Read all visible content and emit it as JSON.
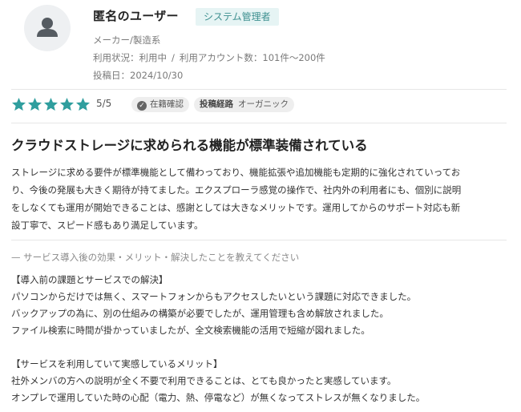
{
  "reviewer": {
    "name": "匿名のユーザー",
    "role": "システム管理者",
    "industry": "メーカー/製造系",
    "usage_status": "利用状況：利用中",
    "account_count": "利用アカウント数：101件〜200件",
    "posted_date": "投稿日：2024/10/30",
    "icon": "user-icon"
  },
  "rating": {
    "value": 5,
    "max": 5,
    "label": "5/5",
    "enrollment_tag": "在籍確認",
    "route_key": "投稿経路",
    "route_value": "オーガニック",
    "star_color": "#2f9e9e"
  },
  "review": {
    "title": "クラウドストレージに求められる機能が標準装備されている",
    "body": "ストレージに求める要件が標準機能として備わっており、機能拡張や追加機能も定期的に強化されていってお\nり、今後の発展も大きく期待が持てました。エクスプローラ感覚の操作で、社内外の利用者にも、個別に説明\nをしなくても運用が開始できることは、感謝としては大きなメリットです。運用してからのサポート対応も新\n設丁寧で、スピード感もあり満足しています。"
  },
  "qa": {
    "question": "— サービス導入後の効果・メリット・解決したことを教えてください",
    "answer": "【導入前の課題とサービスでの解決】\nパソコンからだけでは無く、スマートフォンからもアクセスしたいという課題に対応できました。\nバックアップの為に、別の仕組みの構築が必要でしたが、運用管理も含め解放されました。\nファイル検索に時間が掛かっていましたが、全文検索機能の活用で短縮が図れました。\n\n【サービスを利用していて実感しているメリット】\n社外メンバの方への説明が全く不要で利用できることは、とても良かったと実感しています。\nオンプレで運用していた時の心配（電力、熱、停電など）が無くなってストレスが無くなりました。"
  }
}
